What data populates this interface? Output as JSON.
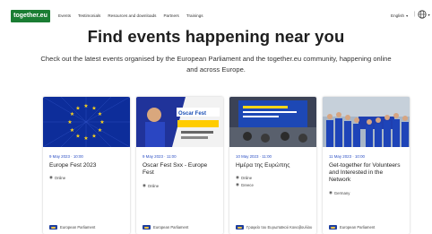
{
  "header": {
    "logo_text": "together.eu",
    "nav": [
      "Events",
      "Testimonials",
      "Resources and downloads",
      "Partners",
      "Trainings"
    ],
    "language": "English",
    "brand_color": "#1a7d33"
  },
  "hero": {
    "title": "Find events happening near you",
    "intro": "Check out the latest events organised by the European Parliament and the together.eu community, happening online and across Europe."
  },
  "events": [
    {
      "date": "9 May 2023 · 10:00",
      "title": "Europe Fest 2023",
      "meta1": "Online",
      "meta2": "",
      "organizer": "European Parliament",
      "image_icon": "eu-flag-image"
    },
    {
      "date": "9 May 2023 · 11:00",
      "title": "Oscar Fest Sxx - Europe Fest",
      "meta1": "Online",
      "meta2": "",
      "organizer": "European Parliament",
      "image_icon": "event-poster-image"
    },
    {
      "date": "10 May 2023 · 11:00",
      "title": "Ημέρα της Ευρώπης",
      "meta1": "Online",
      "meta2": "Greece",
      "organizer": "Γραφείο του Ευρωπαϊκού Κοινοβουλίου",
      "image_icon": "presentation-photo-image"
    },
    {
      "date": "11 May 2023 · 10:00",
      "title": "Get-together for Volunteers and Interested in the Network",
      "meta1": "Germany",
      "meta2": "",
      "organizer": "European Parliament",
      "image_icon": "volunteer-group-photo-image"
    }
  ]
}
